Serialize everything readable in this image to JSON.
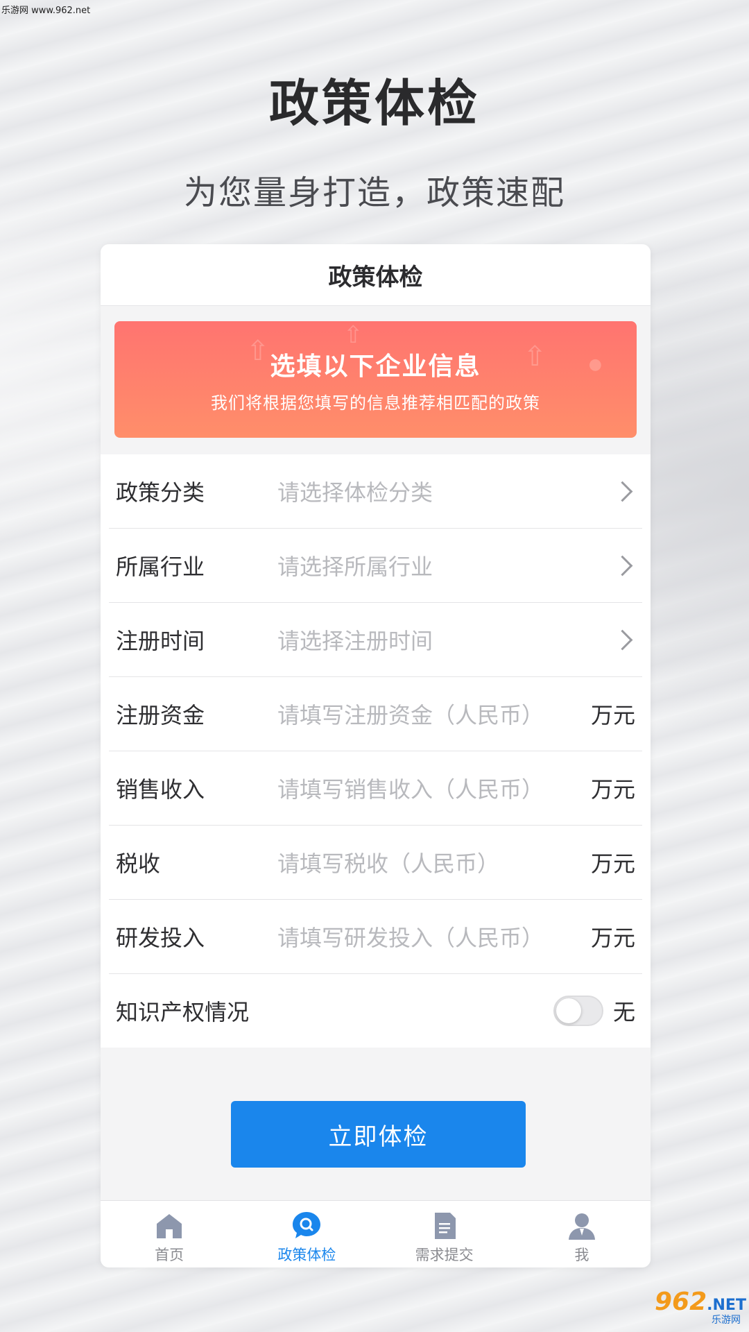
{
  "watermark": "乐游网 www.962.net",
  "hero": {
    "title": "政策体检",
    "subtitle": "为您量身打造，政策速配"
  },
  "card": {
    "header_title": "政策体检",
    "banner": {
      "title": "选填以下企业信息",
      "subtitle": "我们将根据您填写的信息推荐相匹配的政策",
      "gradient": [
        "#ff7470",
        "#ff8e6a"
      ]
    },
    "rows": [
      {
        "label": "政策分类",
        "placeholder": "请选择体检分类",
        "type": "select"
      },
      {
        "label": "所属行业",
        "placeholder": "请选择所属行业",
        "type": "select"
      },
      {
        "label": "注册时间",
        "placeholder": "请选择注册时间",
        "type": "select"
      },
      {
        "label": "注册资金",
        "placeholder": "请填写注册资金（人民币）",
        "unit": "万元",
        "type": "input"
      },
      {
        "label": "销售收入",
        "placeholder": "请填写销售收入（人民币）",
        "unit": "万元",
        "type": "input"
      },
      {
        "label": "税收",
        "placeholder": "请填写税收（人民币）",
        "unit": "万元",
        "type": "input"
      },
      {
        "label": "研发投入",
        "placeholder": "请填写研发投入（人民币）",
        "unit": "万元",
        "type": "input"
      },
      {
        "label": "知识产权情况",
        "toggle_state": "off",
        "toggle_text": "无",
        "type": "toggle"
      }
    ],
    "submit_label": "立即体检",
    "accent": "#1a86ec"
  },
  "tabbar": [
    {
      "label": "首页",
      "icon": "home-icon",
      "active": false
    },
    {
      "label": "政策体检",
      "icon": "search-icon",
      "active": true
    },
    {
      "label": "需求提交",
      "icon": "document-icon",
      "active": false
    },
    {
      "label": "我",
      "icon": "user-icon",
      "active": false
    }
  ],
  "brand_logo": {
    "main": "962",
    "suffix": ".NET",
    "caption": "乐游网"
  }
}
